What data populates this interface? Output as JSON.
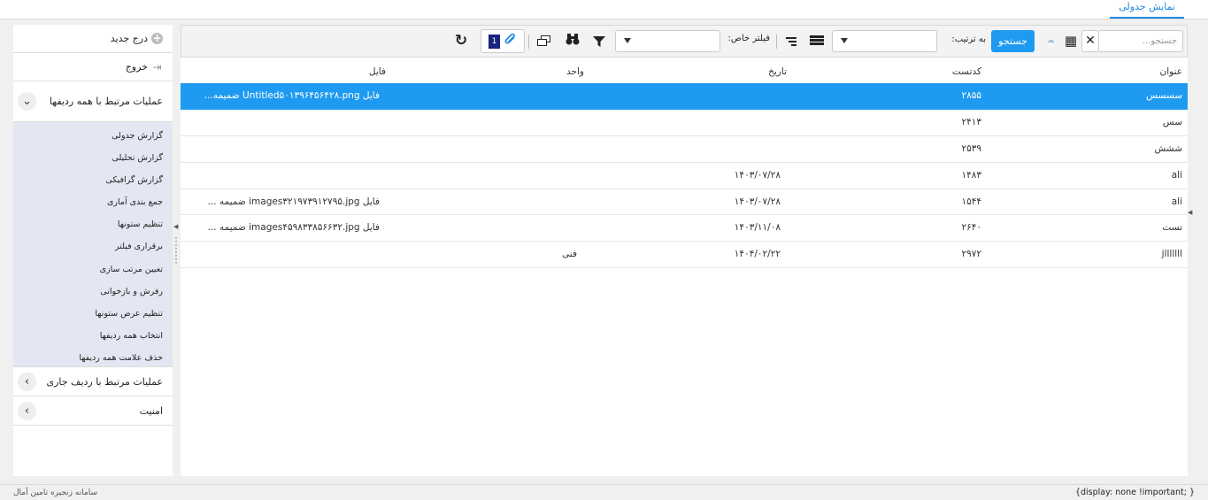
{
  "top_tab": {
    "label": "نمایش جدولی"
  },
  "sidebar": {
    "insert_label": "درج جدید",
    "exit_label": "خروج",
    "all_rows_section": "عملیات مرتبط با همه ردیفها",
    "all_rows_items": [
      {
        "label": "گزارش جدولی"
      },
      {
        "label": "گزارش تحلیلی"
      },
      {
        "label": "گزارش گرافیکی"
      },
      {
        "label": "جمع بندی آماری"
      },
      {
        "label": "تنظیم ستونها"
      },
      {
        "label": "برقراری فیلتر"
      },
      {
        "label": "تعیین مرتب سازی"
      },
      {
        "label": "رفرش و بازخوانی"
      },
      {
        "label": "تنظیم عرض ستونها"
      },
      {
        "label": "انتخاب همه ردیفها"
      },
      {
        "label": "حذف علامت همه ردیفها"
      }
    ],
    "current_row_section": "عملیات مرتبط با ردیف جاری",
    "security_section": "امنیت"
  },
  "toolbar": {
    "search_placeholder": "جستجو...",
    "search_button": "جستجو",
    "sort_label": "به ترتیب:",
    "filter_label": "فیلتر خاص:",
    "attachment_count": "1"
  },
  "table": {
    "columns": {
      "title": "عنوان",
      "code": "کدتست",
      "date": "تاریخ",
      "unit": "واحد",
      "file": "فایل"
    },
    "rows": [
      {
        "title": "سسسس",
        "code": "۲۸۵۵",
        "date": "",
        "unit": "",
        "file": "فایل Untitled۵۰۱۳۹۶۴۵۶۴۲۸.png ضمیمه..."
      },
      {
        "title": "سس",
        "code": "۲۴۱۳",
        "date": "",
        "unit": "",
        "file": ""
      },
      {
        "title": "ششش",
        "code": "۲۵۳۹",
        "date": "",
        "unit": "",
        "file": ""
      },
      {
        "title": "ali",
        "code": "۱۴۸۳",
        "date": "۱۴۰۳/۰۷/۲۸",
        "unit": "",
        "file": ""
      },
      {
        "title": "ali",
        "code": "۱۵۴۴",
        "date": "۱۴۰۳/۰۷/۲۸",
        "unit": "",
        "file": "فایل images۳۲۱۹۷۳۹۱۲۷۹۵.jpg ضمیمه ..."
      },
      {
        "title": "تست",
        "code": "۲۶۴۰",
        "date": "۱۴۰۳/۱۱/۰۸",
        "unit": "",
        "file": "فایل images۴۵۹۸۳۳۸۵۶۶۳۲.jpg ضمیمه ..."
      },
      {
        "title": "jlllllll",
        "code": "۲۹۷۲",
        "date": "۱۴۰۴/۰۲/۲۲",
        "unit": "فنی",
        "file": ""
      }
    ]
  },
  "footer": {
    "css_note": "{display: none !important; }",
    "system_name": "سامانه زنجیره تامین آمال"
  },
  "colors": {
    "accent": "#1e9bf0",
    "sidebar_list_bg": "#e4e6f2",
    "badge": "#1a237e"
  }
}
